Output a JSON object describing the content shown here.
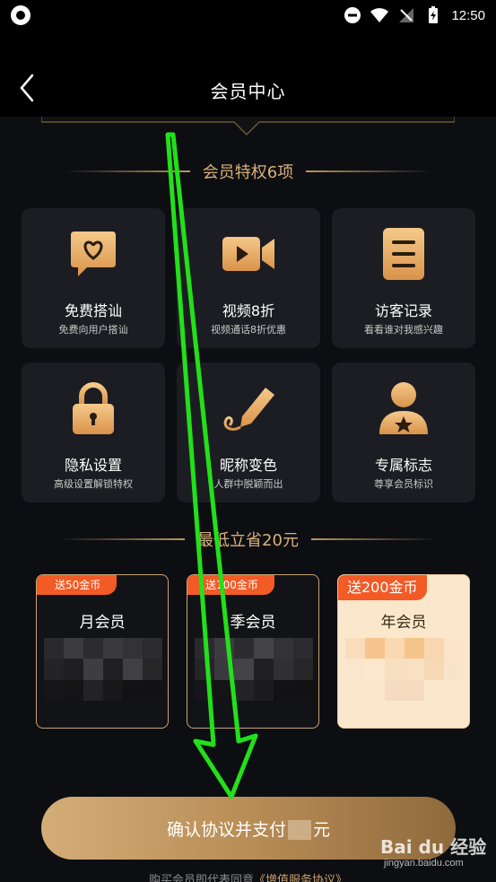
{
  "status_bar": {
    "time": "12:50"
  },
  "header": {
    "title": "会员中心"
  },
  "privileges_section": {
    "title": "会员特权6项",
    "items": [
      {
        "title": "免费搭讪",
        "subtitle": "免费向用户搭讪",
        "icon": "chat-heart-icon"
      },
      {
        "title": "视频8折",
        "subtitle": "视频通话8折优惠",
        "icon": "video-camera-icon"
      },
      {
        "title": "访客记录",
        "subtitle": "看看谁对我感兴趣",
        "icon": "list-document-icon"
      },
      {
        "title": "隐私设置",
        "subtitle": "高级设置解锁特权",
        "icon": "lock-icon"
      },
      {
        "title": "昵称变色",
        "subtitle": "人群中脱颖而出",
        "icon": "pen-icon"
      },
      {
        "title": "专属标志",
        "subtitle": "尊享会员标识",
        "icon": "user-star-icon"
      }
    ]
  },
  "plans_section": {
    "title": "最低立省20元",
    "plans": [
      {
        "badge": "送50金币",
        "name": "月会员",
        "selected": false
      },
      {
        "badge": "送100金币",
        "name": "季会员",
        "selected": false
      },
      {
        "badge": "送200金币",
        "name": "年会员",
        "selected": true
      }
    ]
  },
  "pay_button": {
    "prefix": "确认协议并支付",
    "suffix": "元"
  },
  "agreement": {
    "text": "购买会员即代表同意",
    "link": "《增值服务协议》"
  },
  "watermark": {
    "brand": "Bai du 经验",
    "url": "jingyan.baidu.com"
  },
  "colors": {
    "gold": "#d9b27a",
    "badge": "#f25a26",
    "card": "#1c1d22",
    "background": "#0d0e12",
    "annotation_arrow": "#22e01a"
  }
}
